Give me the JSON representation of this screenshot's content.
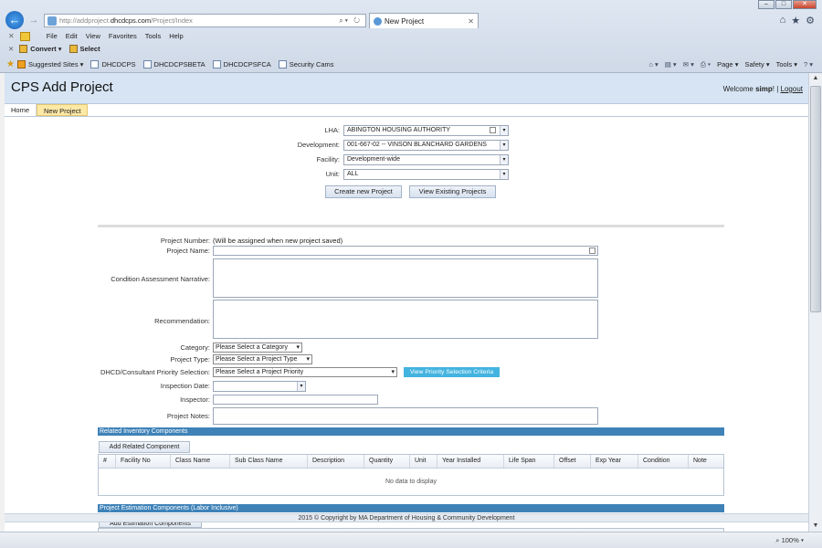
{
  "browser": {
    "address_prefix": "http://addproject.",
    "address_domain": "dhcdcps.com",
    "address_path": "/Project/Index",
    "tab_title": "New Project",
    "menu": [
      "File",
      "Edit",
      "View",
      "Favorites",
      "Tools",
      "Help"
    ],
    "toolbar": {
      "convert": "Convert",
      "select": "Select"
    },
    "favorites": [
      "Suggested Sites",
      "DHCDCPS",
      "DHCDCPSBETA",
      "DHCDCPSFCA",
      "Security Cams"
    ],
    "command_bar": {
      "page": "Page",
      "safety": "Safety",
      "tools": "Tools"
    },
    "zoom": "100%"
  },
  "header": {
    "title": "CPS Add Project",
    "welcome_prefix": "Welcome",
    "user": "simp",
    "welcome_suffix": "!",
    "sep": "|",
    "logout": "Logout"
  },
  "nav": {
    "home": "Home",
    "new_project": "New Project"
  },
  "filters": {
    "lha_label": "LHA:",
    "lha_value": "ABINGTON HOUSING AUTHORITY",
    "development_label": "Development:",
    "development_value": "001-667-02 -- VINSON BLANCHARD GARDENS",
    "facility_label": "Facility:",
    "facility_value": "Development-wide",
    "unit_label": "Unit:",
    "unit_value": "ALL",
    "create_button": "Create new Project",
    "view_button": "View Existing Projects"
  },
  "form": {
    "project_number_label": "Project Number:",
    "project_number_value": "(Will be assigned when new project saved)",
    "project_name_label": "Project Name:",
    "narrative_label": "Condition Assessment Narrative:",
    "recommendation_label": "Recommendation:",
    "category_label": "Category:",
    "category_value": "Please Select a Category",
    "project_type_label": "Project Type:",
    "project_type_value": "Please Select a Project Type",
    "priority_label": "DHCD/Consultant Priority Selection:",
    "priority_value": "Please Select a Project Priority",
    "priority_criteria_button": "View Priority Selection Criteria",
    "inspection_date_label": "Inspection Date:",
    "inspector_label": "Inspector:",
    "project_notes_label": "Project Notes:"
  },
  "related": {
    "section_title": "Related Inventory Components",
    "add_button": "Add Related Component",
    "columns": [
      "#",
      "Facility No",
      "Class Name",
      "Sub Class Name",
      "Description",
      "Quantity",
      "Unit",
      "Year Installed",
      "Life Span",
      "Offset",
      "Exp Year",
      "Condition",
      "Note"
    ],
    "empty_text": "No data to display"
  },
  "estimation": {
    "section_title": "Project Estimation Components (Labor Inclusive)",
    "add_button": "Add Estimation Components"
  },
  "footer": {
    "copyright": "2015 © Copyright by MA Department of Housing & Community Development"
  }
}
